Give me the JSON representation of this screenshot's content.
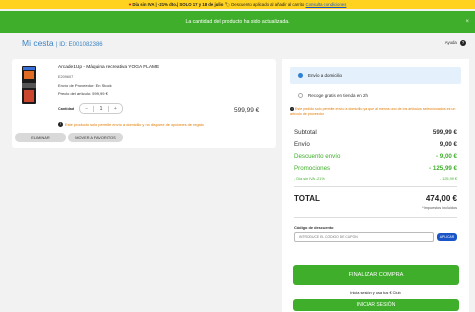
{
  "promo": {
    "part1": "Día sin IVA | -21% dto.| SOLO 17 y 18 de julio",
    "part2": "Descuento aplicado al añadir al carrito",
    "link": "Consulta condiciones"
  },
  "notice": {
    "text": "La cantidad del producto ha sido actualizada.",
    "close": "×"
  },
  "cart": {
    "title": "Mi cesta",
    "id_label": "ID: E001082386"
  },
  "help": {
    "label": "Ayuda",
    "icon": "?"
  },
  "item": {
    "name": "Arcade1Up - Máquina recreativa YOGA FLAME",
    "ref": "E209607",
    "provider": "Envío de Proveedor: En Stock",
    "unit_price": "Precio del artículo: 599,99 €",
    "qty_label": "Cantidad",
    "qty_minus": "−",
    "qty": "1",
    "qty_plus": "+",
    "line_price": "599,99 €",
    "warning": "Este producto solo permite envío a domicilio y no dispone de opciones de regalo",
    "remove": "ELIMINAR",
    "favorite": "MOVER A FAVORITOS"
  },
  "shipping": {
    "home": "Envío a domicilio",
    "pickup": "Recoge gratis en tienda en 2h",
    "pickup_note": "Este pedido solo permite envío a domicilio ya que al menos uno de los artículos seleccionados es un artículo de proveedor"
  },
  "summary": {
    "subtotal_label": "Subtotal",
    "subtotal": "599,99 €",
    "envio_label": "Envío",
    "envio": "9,00 €",
    "descuento_label": "Descuento envío",
    "descuento": "- 9,00 €",
    "promos_label": "Promociones",
    "promos": "- 125,99 €",
    "iva_label": "- Día sin IVA -21%",
    "iva": "- 125,99 €",
    "total_label": "TOTAL",
    "total": "474,00 €",
    "tax_note": "*Impuestos incluidos"
  },
  "coupon": {
    "label": "Código de descuento",
    "placeholder": "INTRODUCE EL CÓDIGO DE CUPÓN",
    "apply": "APLICAR"
  },
  "checkout": {
    "finalize": "FINALIZAR COMPRA",
    "login_note": "Inicia sesión y usa tus € Club",
    "login": "INICIAR SESIÓN"
  },
  "colors": {
    "green": "#3fae2a",
    "blue": "#3c83c4",
    "yellow": "#ffd21f",
    "orange": "#e07b00"
  }
}
